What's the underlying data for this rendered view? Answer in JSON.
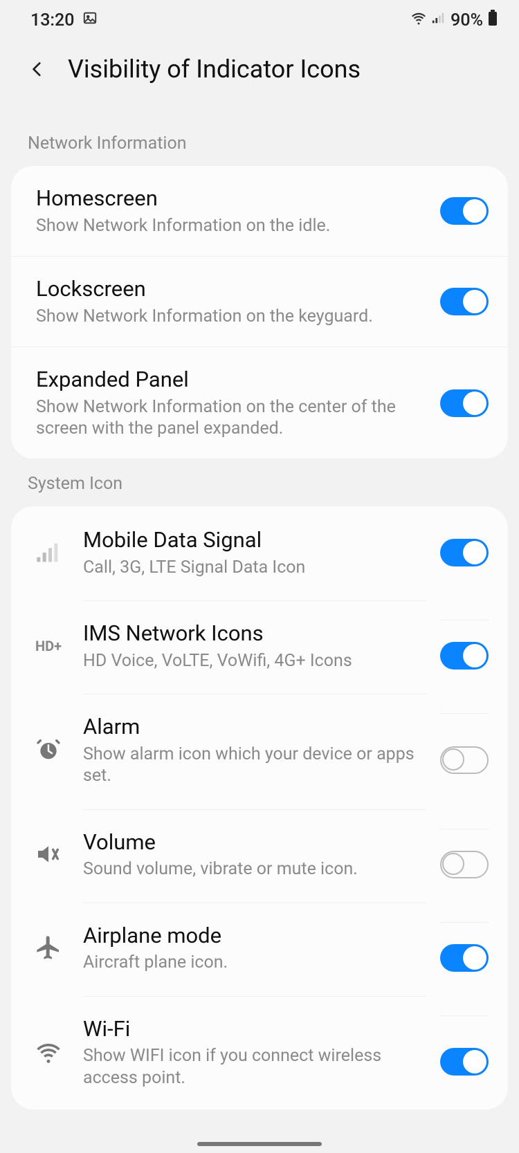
{
  "status": {
    "time": "13:20",
    "battery": "90%"
  },
  "header": {
    "title": "Visibility of Indicator Icons"
  },
  "sections": {
    "network": {
      "label": "Network Information",
      "items": [
        {
          "title": "Homescreen",
          "sub": "Show Network Information on the idle.",
          "on": true
        },
        {
          "title": "Lockscreen",
          "sub": "Show Network Information on the keyguard.",
          "on": true
        },
        {
          "title": "Expanded Panel",
          "sub": "Show Network Information on the center of the screen with the panel expanded.",
          "on": true
        }
      ]
    },
    "system": {
      "label": "System Icon",
      "items": [
        {
          "title": "Mobile Data Signal",
          "sub": "Call, 3G, LTE Signal Data Icon",
          "on": true,
          "icon": "signal"
        },
        {
          "title": "IMS Network Icons",
          "sub": "HD Voice, VoLTE, VoWifi, 4G+ Icons",
          "on": true,
          "icon": "hdplus"
        },
        {
          "title": "Alarm",
          "sub": "Show alarm icon which your device or apps set.",
          "on": false,
          "icon": "alarm"
        },
        {
          "title": "Volume",
          "sub": "Sound volume, vibrate or mute icon.",
          "on": false,
          "icon": "volume"
        },
        {
          "title": "Airplane mode",
          "sub": "Aircraft plane icon.",
          "on": true,
          "icon": "airplane"
        },
        {
          "title": "Wi-Fi",
          "sub": "Show WIFI icon if you connect wireless access point.",
          "on": true,
          "icon": "wifi"
        }
      ]
    }
  },
  "hd_label": "HD+"
}
